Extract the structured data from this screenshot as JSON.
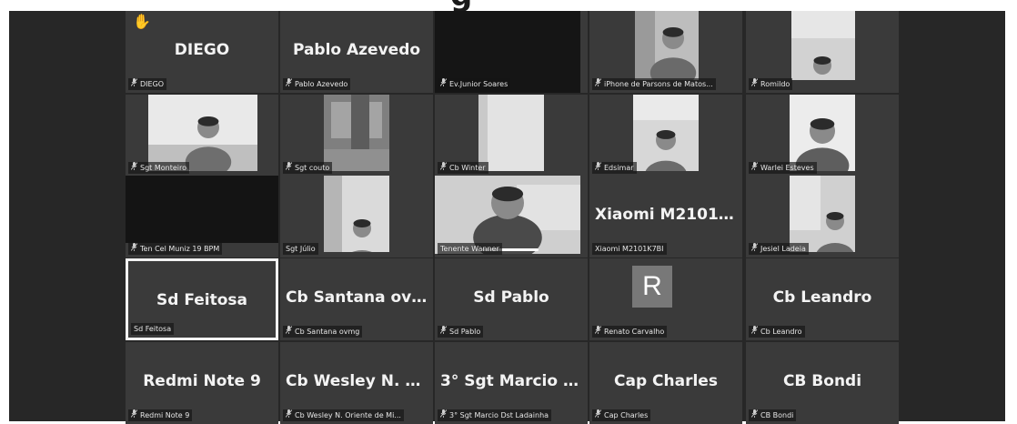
{
  "meeting": {
    "title_fragment": "g",
    "tiles": [
      {
        "id": "diego",
        "name": "DIEGO",
        "label": "DIEGO",
        "muted": true,
        "raised_hand": true
      },
      {
        "id": "pablo-azevedo",
        "name": "Pablo Azevedo",
        "label": "Pablo Azevedo",
        "muted": true
      },
      {
        "id": "junior-soares",
        "name": "",
        "label": "Ev.Junior Soares",
        "muted": true,
        "video": true
      },
      {
        "id": "iphone-parsons",
        "name": "",
        "label": "iPhone de Parsons de Matos...",
        "muted": true,
        "video": true
      },
      {
        "id": "romildo",
        "name": "",
        "label": "Romildo",
        "muted": true,
        "video": true
      },
      {
        "id": "sgt-monteiro",
        "name": "",
        "label": "Sgt Monteiro",
        "muted": true,
        "video": true
      },
      {
        "id": "sgt-couto",
        "name": "",
        "label": "Sgt couto",
        "muted": true,
        "video": true
      },
      {
        "id": "cb-winter",
        "name": "",
        "label": "Cb Winter",
        "muted": true,
        "video": true
      },
      {
        "id": "edsimar",
        "name": "",
        "label": "Edsimar",
        "muted": true,
        "video": true
      },
      {
        "id": "warlei-esteves",
        "name": "",
        "label": "Warlei Esteves",
        "muted": true,
        "video": true
      },
      {
        "id": "ten-cel-muniz",
        "name": "",
        "label": "Ten Cel Muniz 19 BPM",
        "muted": true,
        "video": true
      },
      {
        "id": "sgt-julio",
        "name": "",
        "label": "Sgt Júlio",
        "muted": false,
        "video": true
      },
      {
        "id": "tenente-wanner",
        "name": "",
        "label": "Tenente Wanner",
        "muted": false,
        "video": true,
        "speaking": true
      },
      {
        "id": "xiaomi",
        "name": "Xiaomi  M2101K...",
        "label": "Xiaomi M2101K7BI",
        "muted": false
      },
      {
        "id": "jesiel-ladeia",
        "name": "",
        "label": "Jesiel Ladeia",
        "muted": true,
        "video": true
      },
      {
        "id": "sd-feitosa",
        "name": "Sd Feitosa",
        "label": "Sd Feitosa",
        "muted": false,
        "active": true
      },
      {
        "id": "cb-santana",
        "name": "Cb Santana ovmg",
        "label": "Cb Santana ovmg",
        "muted": true
      },
      {
        "id": "sd-pablo",
        "name": "Sd Pablo",
        "label": "Sd Pablo",
        "muted": true
      },
      {
        "id": "renato-carvalho",
        "name": "",
        "label": "Renato Carvalho",
        "muted": true,
        "avatar": "R"
      },
      {
        "id": "cb-leandro",
        "name": "Cb Leandro",
        "label": "Cb Leandro",
        "muted": true
      },
      {
        "id": "redmi-note-9",
        "name": "Redmi Note 9",
        "label": "Redmi Note 9",
        "muted": true
      },
      {
        "id": "cb-wesley",
        "name": "Cb Wesley N. O...",
        "label": "Cb Wesley N. Oriente de Mi...",
        "muted": true
      },
      {
        "id": "sgt-marcio",
        "name": "3° Sgt Marcio D...",
        "label": "3° Sgt Marcio Dst Ladainha",
        "muted": true
      },
      {
        "id": "cap-charles",
        "name": "Cap Charles",
        "label": "Cap Charles",
        "muted": true
      },
      {
        "id": "cb-bondi",
        "name": "CB Bondi",
        "label": "CB Bondi",
        "muted": true
      }
    ]
  },
  "icons": {
    "muted": "muted-mic-icon",
    "hand": "raised-hand-icon"
  },
  "colors": {
    "background": "#272727",
    "tile": "#3a3a3a",
    "active_border": "#f2f2f2",
    "avatar": "#787878"
  }
}
